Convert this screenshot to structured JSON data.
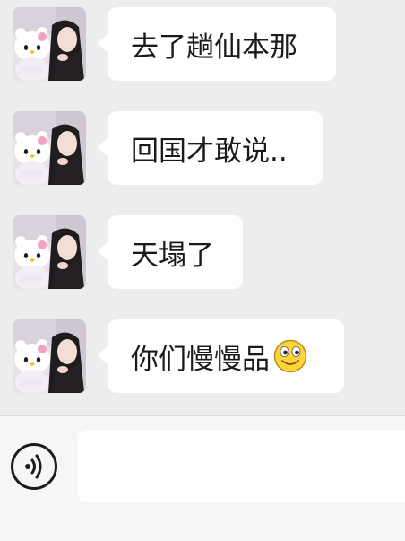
{
  "messages": [
    {
      "text": "去了趟仙本那",
      "avatar": "contact-avatar"
    },
    {
      "text": "回国才敢说..",
      "avatar": "contact-avatar"
    },
    {
      "text": "天塌了",
      "avatar": "contact-avatar"
    },
    {
      "text": "你们慢慢品",
      "avatar": "contact-avatar",
      "emoji": "smiley-face"
    }
  ],
  "input": {
    "value": "",
    "voice_icon": "voice-icon"
  },
  "colors": {
    "chat_bg": "#ededed",
    "bubble": "#ffffff",
    "input_bar": "#f6f6f6"
  }
}
